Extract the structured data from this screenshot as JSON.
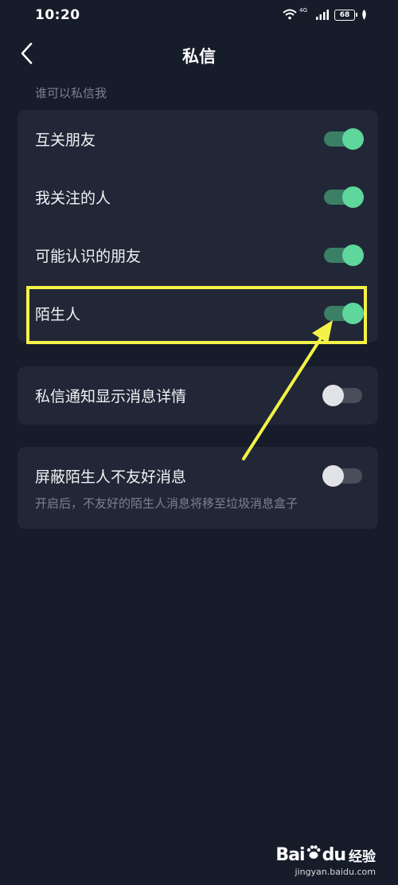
{
  "status_bar": {
    "time": "10:20",
    "network": "4G",
    "battery": "68"
  },
  "header": {
    "title": "私信"
  },
  "section": {
    "label": "谁可以私信我"
  },
  "who_can_message": [
    {
      "label": "互关朋友",
      "enabled": true
    },
    {
      "label": "我关注的人",
      "enabled": true
    },
    {
      "label": "可能认识的朋友",
      "enabled": true
    },
    {
      "label": "陌生人",
      "enabled": true
    }
  ],
  "notification": {
    "label": "私信通知显示消息详情",
    "enabled": false
  },
  "block_strangers": {
    "label": "屏蔽陌生人不友好消息",
    "enabled": false,
    "description": "开启后，不友好的陌生人消息将移至垃圾消息盒子"
  },
  "annotation": {
    "highlight_color": "#f4f248"
  },
  "colors": {
    "background": "#171c2a",
    "card": "#222737",
    "toggle_on": "#5fd69c",
    "toggle_off": "#e2e3e7"
  },
  "watermark": {
    "brand_a": "Bai",
    "brand_b": "du",
    "brand_cn": "经验",
    "url": "jingyan.baidu.com"
  }
}
